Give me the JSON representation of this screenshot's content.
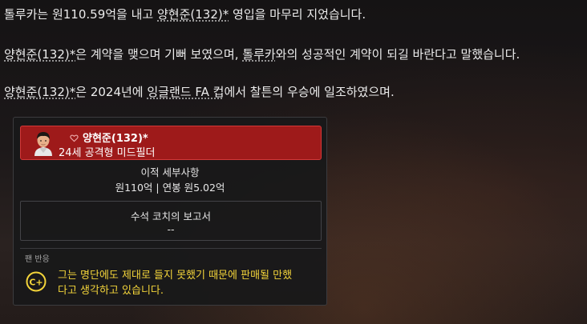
{
  "news": {
    "p1_pre": "톨루카는 원110.59억을 내고 ",
    "p1_name": "양현준(132)*",
    "p1_post": " 영입을 마무리 지었습니다.",
    "p2_name": "양현준(132)*",
    "p2_mid": "은 계약을 맺으며 기뻐 보였으며, ",
    "p2_club": "톨루카",
    "p2_post": "와의 성공적인 계약이 되길 바란다고 말했습니다.",
    "p3_name": "양현준(132)*",
    "p3_mid": "은 2024년에 ",
    "p3_cup": "잉글랜드 FA 컵",
    "p3_post": "에서 찰튼의 우승에 일조하였으며."
  },
  "card": {
    "player_name": "양현준(132)*",
    "player_role": "24세 공격형 미드필더",
    "transfer_title": "이적 세부사항",
    "transfer_value": "원110억 | 연봉 원5.02억",
    "report_title": "수석 코치의 보고서",
    "report_value": "--",
    "fan_label": "팬 반응",
    "fan_grade": "C+",
    "fan_text": "그는 명단에도 제대로 들지 못했기 때문에 판매될 만했다고 생각하고 있습니다."
  },
  "icons": {
    "favorite": "heart-outline-icon",
    "avatar": "player-avatar",
    "fan_grade": "grade-badge-icon"
  },
  "colors": {
    "player_bar": "#9e1a1a",
    "fan_text": "#f3d43a"
  }
}
